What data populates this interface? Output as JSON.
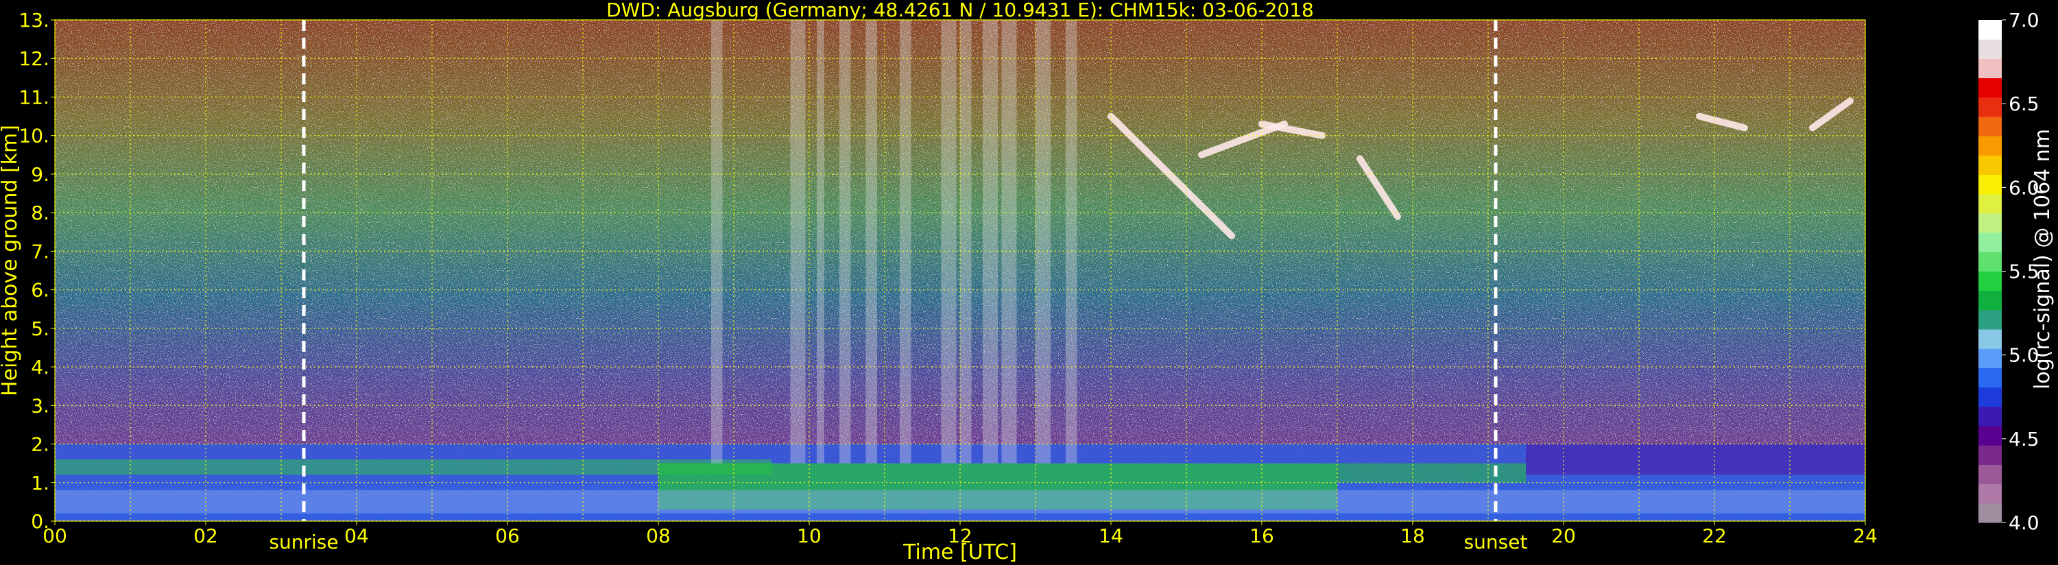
{
  "chart_data": {
    "type": "heatmap",
    "title": "DWD: Augsburg (Germany; 48.4261 N / 10.9431 E):    CHM15k: 03-06-2018",
    "xlabel": "Time [UTC]",
    "ylabel": "Height above ground [km]",
    "colorbar_label": "log(rc-signal) @ 1064 nm",
    "xlim": [
      0,
      24
    ],
    "ylim": [
      0,
      13
    ],
    "x_ticks": [
      "00",
      "02",
      "04",
      "06",
      "08",
      "10",
      "12",
      "14",
      "16",
      "18",
      "20",
      "22",
      "24"
    ],
    "y_ticks": [
      "0.",
      "1.",
      "2.",
      "3.",
      "4.",
      "5.",
      "6.",
      "7.",
      "8.",
      "9.",
      "10.",
      "11.",
      "12.",
      "13."
    ],
    "colorbar_range": [
      4.0,
      7.0
    ],
    "colorbar_ticks": [
      "4.0",
      "4.5",
      "5.0",
      "5.5",
      "6.0",
      "6.5",
      "7.0"
    ],
    "colorbar_colors": [
      "#9e8ea0",
      "#b07aa8",
      "#9a5a9a",
      "#7a2a8a",
      "#5a0090",
      "#3a1ab0",
      "#1e3cdc",
      "#2a6af0",
      "#5a9cf8",
      "#8ac8e8",
      "#2aa080",
      "#10b040",
      "#20d040",
      "#60e070",
      "#90f0a0",
      "#c0f080",
      "#e0f040",
      "#f8f000",
      "#f8c800",
      "#f89a00",
      "#f06a10",
      "#e83010",
      "#e80000",
      "#f0c0c0",
      "#e8e0e0",
      "#ffffff"
    ],
    "grid": true,
    "grid_color": "#ffff00",
    "annotations": [
      {
        "label": "sunrise",
        "x": 3.3
      },
      {
        "label": "sunset",
        "x": 19.1
      }
    ],
    "cirrus_clouds": [
      {
        "x_start": 14.0,
        "x_end": 15.6,
        "y_start": 10.5,
        "y_end": 7.4
      },
      {
        "x_start": 15.2,
        "x_end": 16.3,
        "y_start": 9.5,
        "y_end": 10.3
      },
      {
        "x_start": 16.0,
        "x_end": 16.8,
        "y_start": 10.3,
        "y_end": 10.0
      },
      {
        "x_start": 17.3,
        "x_end": 17.8,
        "y_start": 9.4,
        "y_end": 7.9
      },
      {
        "x_start": 21.8,
        "x_end": 22.4,
        "y_start": 10.5,
        "y_end": 10.2
      },
      {
        "x_start": 23.3,
        "x_end": 23.8,
        "y_start": 10.2,
        "y_end": 10.9
      }
    ]
  }
}
